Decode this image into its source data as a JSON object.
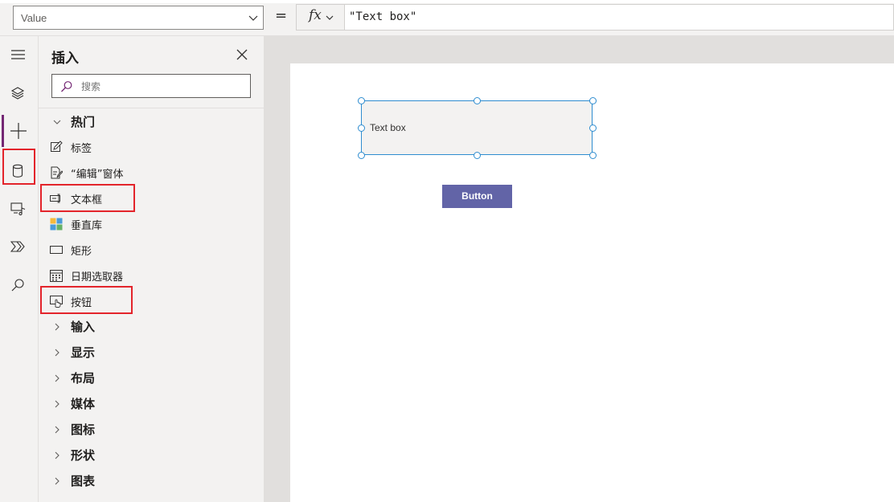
{
  "formula_bar": {
    "property": "Value",
    "equals": "=",
    "fx": "fx",
    "formula": "\"Text box\""
  },
  "rail": {
    "items": [
      {
        "name": "menu-icon"
      },
      {
        "name": "tree-view-icon"
      },
      {
        "name": "insert-icon",
        "active": true
      },
      {
        "name": "data-icon"
      },
      {
        "name": "media-icon"
      },
      {
        "name": "power-automate-icon"
      },
      {
        "name": "search-icon"
      }
    ]
  },
  "panel": {
    "title": "插入",
    "search_placeholder": "搜索",
    "popular": {
      "label": "热门",
      "items": [
        {
          "label": "标签",
          "icon": "label-icon"
        },
        {
          "label": "“编辑”窗体",
          "icon": "edit-form-icon"
        },
        {
          "label": "文本框",
          "icon": "text-input-icon"
        },
        {
          "label": "垂直库",
          "icon": "gallery-icon"
        },
        {
          "label": "矩形",
          "icon": "rectangle-icon"
        },
        {
          "label": "日期选取器",
          "icon": "calendar-icon"
        },
        {
          "label": "按钮",
          "icon": "button-icon"
        }
      ]
    },
    "categories": [
      "输入",
      "显示",
      "布局",
      "媒体",
      "图标",
      "形状",
      "图表"
    ]
  },
  "canvas": {
    "textbox_text": "Text box",
    "button_label": "Button"
  },
  "colors": {
    "highlight": "#e3242b",
    "accent": "#742774",
    "selection": "#2f8dd0",
    "button": "#6264a7"
  }
}
